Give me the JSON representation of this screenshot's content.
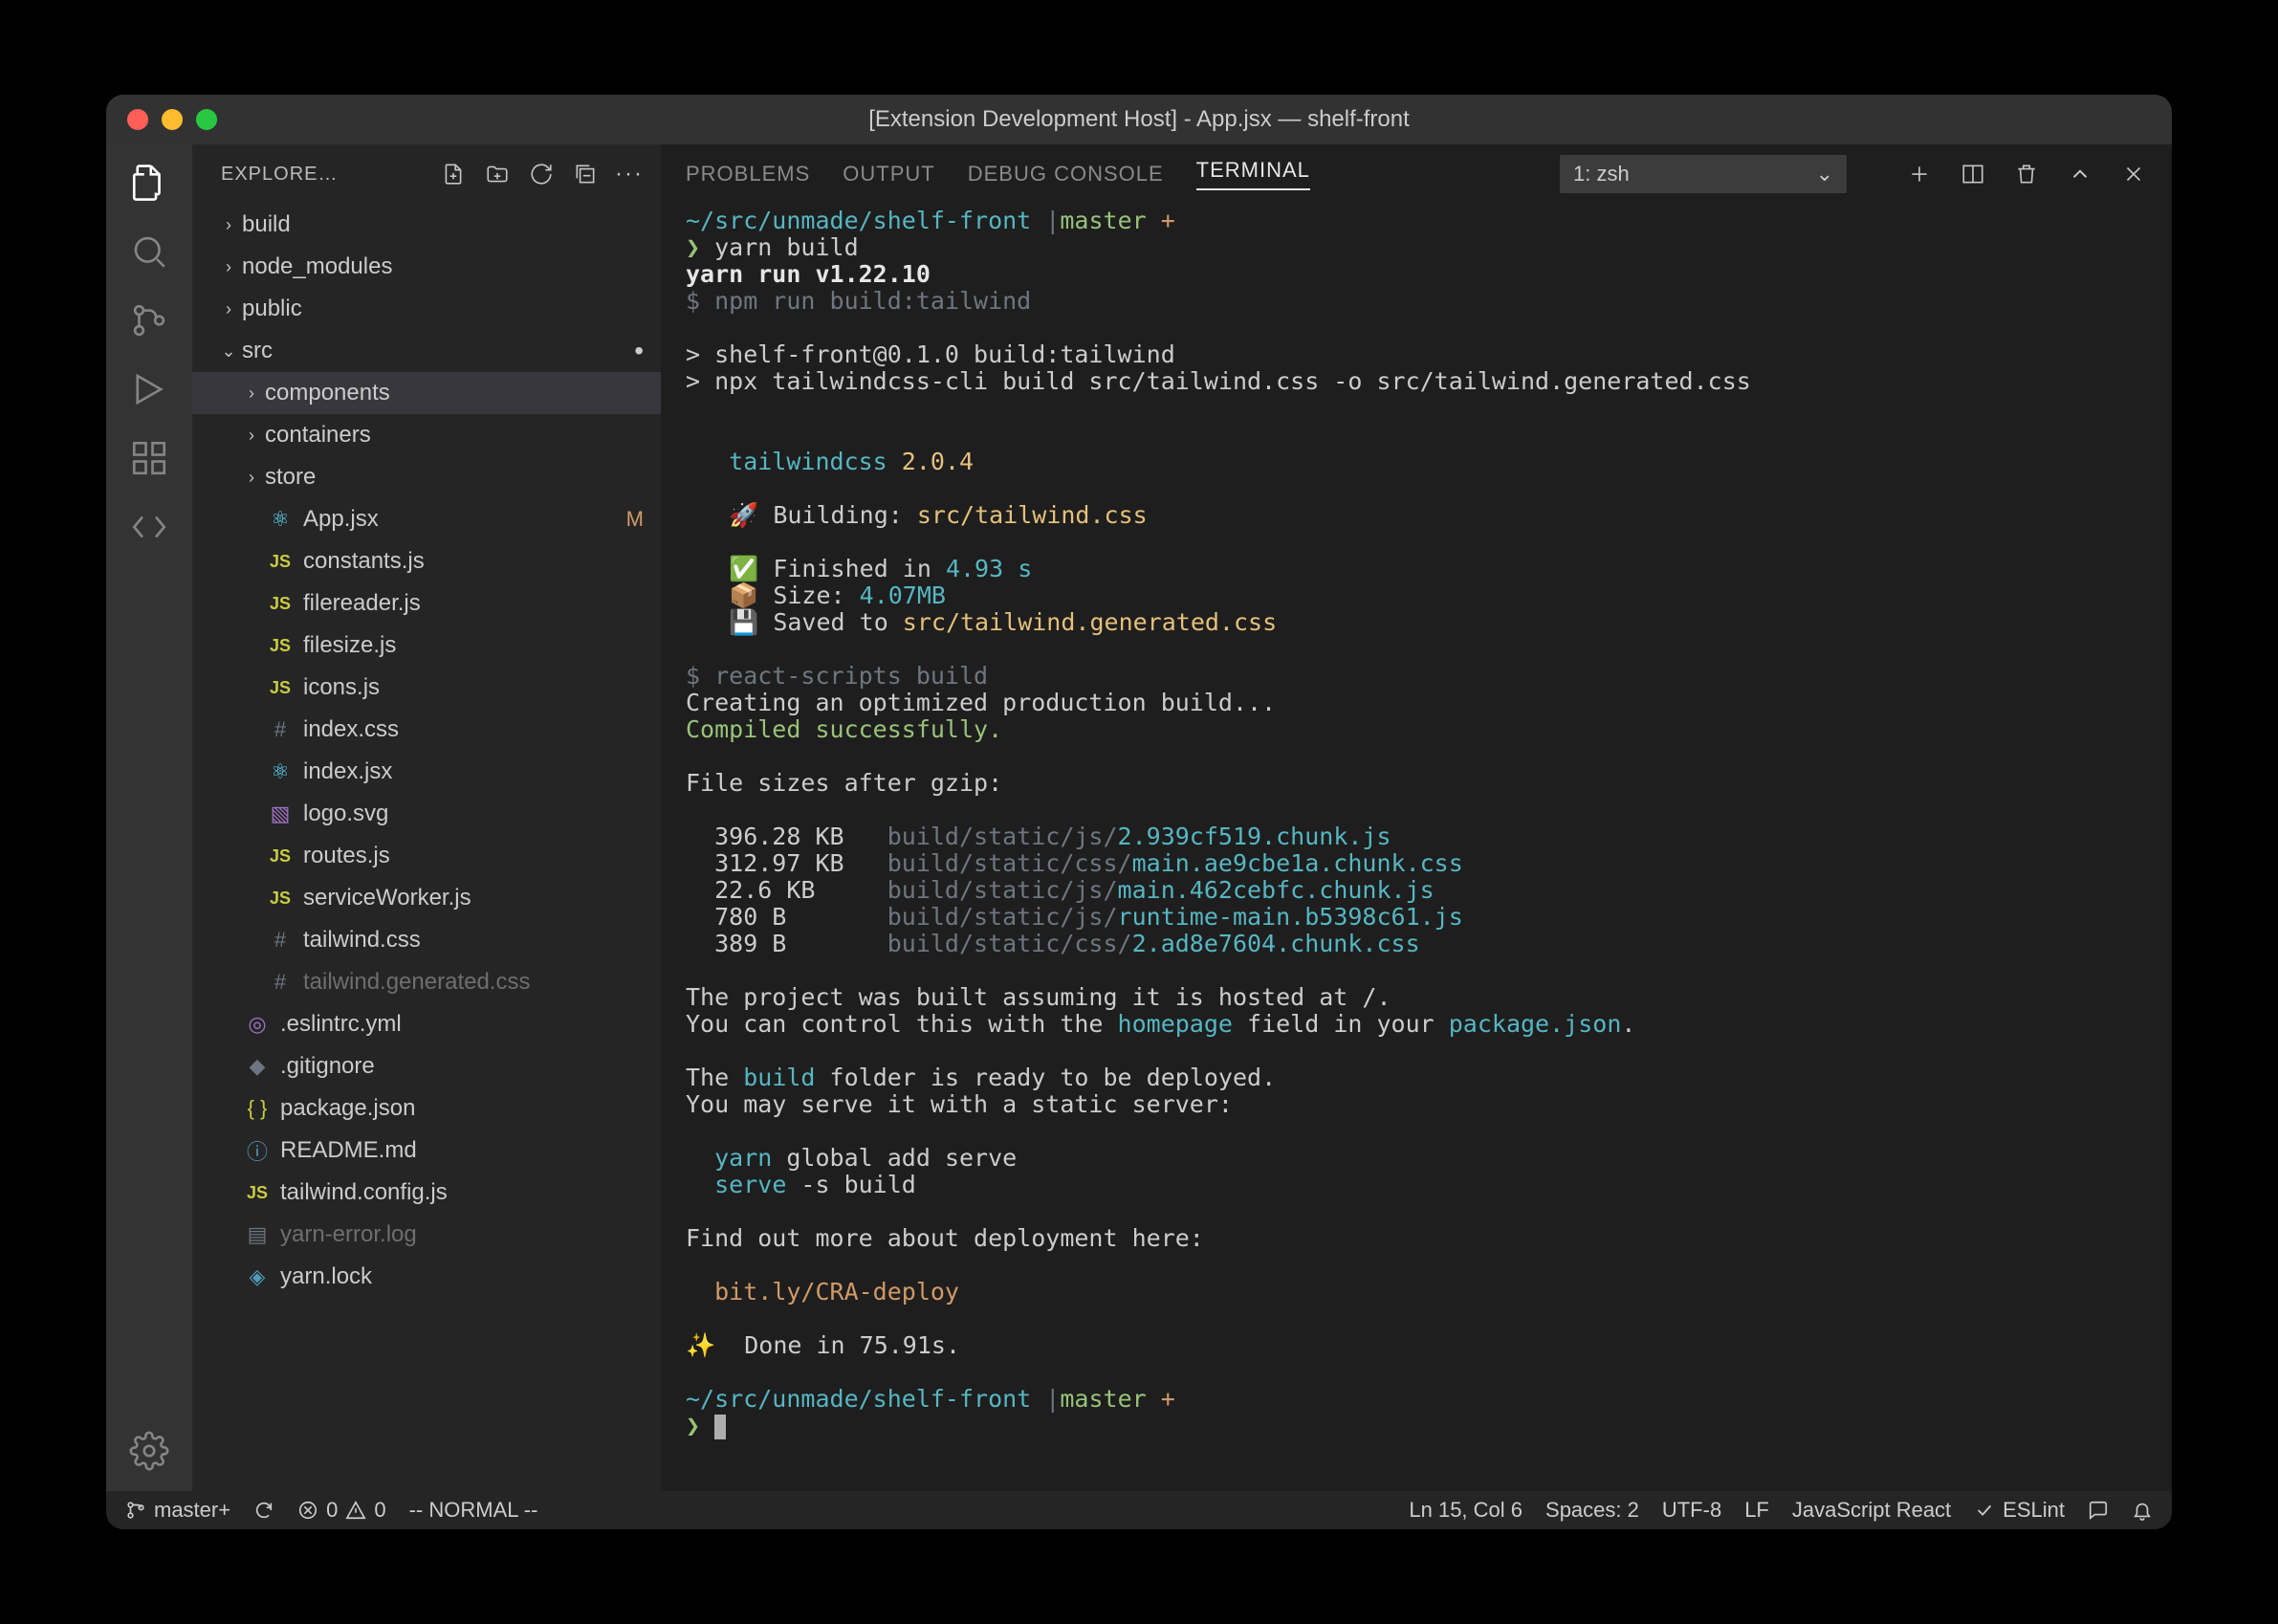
{
  "title": "[Extension Development Host] - App.jsx — shelf-front",
  "sidebar": {
    "header": "EXPLORE…",
    "tree": [
      {
        "kind": "folder",
        "depth": 1,
        "open": false,
        "name": "build",
        "twisty": "›"
      },
      {
        "kind": "folder",
        "depth": 1,
        "open": false,
        "name": "node_modules",
        "twisty": "›"
      },
      {
        "kind": "folder",
        "depth": 1,
        "open": false,
        "name": "public",
        "twisty": "›"
      },
      {
        "kind": "folder",
        "depth": 1,
        "open": true,
        "name": "src",
        "twisty": "⌄",
        "dot": true
      },
      {
        "kind": "folder",
        "depth": 2,
        "open": false,
        "name": "components",
        "twisty": "›",
        "selected": true
      },
      {
        "kind": "folder",
        "depth": 2,
        "open": false,
        "name": "containers",
        "twisty": "›"
      },
      {
        "kind": "folder",
        "depth": 2,
        "open": false,
        "name": "store",
        "twisty": "›"
      },
      {
        "kind": "file",
        "depth": 2,
        "name": "App.jsx",
        "icon": "react",
        "badge": "M"
      },
      {
        "kind": "file",
        "depth": 2,
        "name": "constants.js",
        "icon": "js"
      },
      {
        "kind": "file",
        "depth": 2,
        "name": "filereader.js",
        "icon": "js"
      },
      {
        "kind": "file",
        "depth": 2,
        "name": "filesize.js",
        "icon": "js"
      },
      {
        "kind": "file",
        "depth": 2,
        "name": "icons.js",
        "icon": "js"
      },
      {
        "kind": "file",
        "depth": 2,
        "name": "index.css",
        "icon": "hash"
      },
      {
        "kind": "file",
        "depth": 2,
        "name": "index.jsx",
        "icon": "react"
      },
      {
        "kind": "file",
        "depth": 2,
        "name": "logo.svg",
        "icon": "svg"
      },
      {
        "kind": "file",
        "depth": 2,
        "name": "routes.js",
        "icon": "js"
      },
      {
        "kind": "file",
        "depth": 2,
        "name": "serviceWorker.js",
        "icon": "js"
      },
      {
        "kind": "file",
        "depth": 2,
        "name": "tailwind.css",
        "icon": "hash"
      },
      {
        "kind": "file",
        "depth": 2,
        "name": "tailwind.generated.css",
        "icon": "hash",
        "dim": true
      },
      {
        "kind": "file",
        "depth": 1,
        "name": ".eslintrc.yml",
        "icon": "yaml"
      },
      {
        "kind": "file",
        "depth": 1,
        "name": ".gitignore",
        "icon": "git"
      },
      {
        "kind": "file",
        "depth": 1,
        "name": "package.json",
        "icon": "json"
      },
      {
        "kind": "file",
        "depth": 1,
        "name": "README.md",
        "icon": "info"
      },
      {
        "kind": "file",
        "depth": 1,
        "name": "tailwind.config.js",
        "icon": "js"
      },
      {
        "kind": "file",
        "depth": 1,
        "name": "yarn-error.log",
        "icon": "file",
        "dim": true
      },
      {
        "kind": "file",
        "depth": 1,
        "name": "yarn.lock",
        "icon": "lock"
      }
    ]
  },
  "panel": {
    "tabs": [
      "PROBLEMS",
      "OUTPUT",
      "DEBUG CONSOLE",
      "TERMINAL"
    ],
    "active": 3,
    "terminalSelect": "1: zsh"
  },
  "terminal": {
    "cwd": "~/src/unmade/shelf-front",
    "branch": "master +",
    "prompt": "❯",
    "cmd1": "yarn build",
    "yarnRun": "yarn run v1.22.10",
    "npmRun": "$ npm run build:tailwind",
    "buildHdr": "> shelf-front@0.1.0 build:tailwind",
    "npxLine": "> npx tailwindcss-cli build src/tailwind.css -o src/tailwind.generated.css",
    "twLabel": "tailwindcss",
    "twVersion": "2.0.4",
    "building": "Building:",
    "buildingPath": "src/tailwind.css",
    "finished": "Finished in",
    "finishedTime": "4.93 s",
    "size": "Size:",
    "sizeVal": "4.07MB",
    "saved": "Saved to",
    "savedPath": "src/tailwind.generated.css",
    "reactScripts": "$ react-scripts build",
    "creating": "Creating an optimized production build...",
    "compiled": "Compiled successfully.",
    "fileSizesHdr": "File sizes after gzip:",
    "files": [
      {
        "size": "396.28 KB",
        "path": "build/static/js/",
        "file": "2.939cf519.chunk.js"
      },
      {
        "size": "312.97 KB",
        "path": "build/static/css/",
        "file": "main.ae9cbe1a.chunk.css"
      },
      {
        "size": "22.6 KB",
        "path": "build/static/js/",
        "file": "main.462cebfc.chunk.js"
      },
      {
        "size": "780 B",
        "path": "build/static/js/",
        "file": "runtime-main.b5398c61.js"
      },
      {
        "size": "389 B",
        "path": "build/static/css/",
        "file": "2.ad8e7604.chunk.css"
      }
    ],
    "hosted1": "The project was built assuming it is hosted at /.",
    "hosted2a": "You can control this with the ",
    "hosted2b": "homepage",
    "hosted2c": " field in your ",
    "hosted2d": "package.json",
    "hosted2e": ".",
    "deploy1a": "The ",
    "deploy1b": "build",
    "deploy1c": " folder is ready to be deployed.",
    "deploy2": "You may serve it with a static server:",
    "serve1a": "yarn",
    "serve1b": " global add serve",
    "serve2a": "serve",
    "serve2b": " -s build",
    "findOut": "Find out more about deployment here:",
    "deployLink": "bit.ly/CRA-deploy",
    "done": "Done in 75.91s."
  },
  "status": {
    "branch": "master+",
    "errors": "0",
    "warnings": "0",
    "mode": "-- NORMAL --",
    "cursor": "Ln 15, Col 6",
    "spaces": "Spaces: 2",
    "encoding": "UTF-8",
    "eol": "LF",
    "lang": "JavaScript React",
    "eslint": "ESLint"
  }
}
